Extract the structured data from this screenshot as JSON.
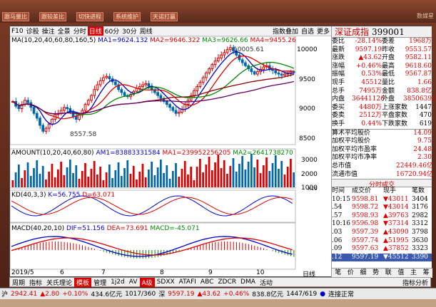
{
  "top_buttons": [
    "跟马量比",
    "跟较差比",
    "切快进程",
    "系统维护",
    "天诺打赢"
  ],
  "top_right": "数媒星",
  "toolbar": {
    "items": [
      "F10",
      "诊股",
      "操注",
      "全景",
      "分时",
      "日线",
      "60分",
      "30分",
      "周线"
    ],
    "selected": "日线",
    "right": [
      "指数叠加",
      "自选",
      "更多"
    ]
  },
  "yaxis": {
    "price": [
      "10000",
      "9500",
      "9000",
      "8500"
    ],
    "vol": [
      "3000",
      "2000",
      "1000"
    ],
    "vol_unit": "X10"
  },
  "price_high": "10005.61",
  "price_low": "8557.58",
  "ma_legend": {
    "type": "MA",
    "params": "(10,20,40,60,80,160,5)",
    "ma1": "MA1=9624.132",
    "ma2": "MA2=9646.322",
    "ma3": "MA3=9626.66",
    "ma4": "MA4=9455.26"
  },
  "amount_legend": {
    "name": "AMOUNT",
    "params": "(10,20,40,60,80)",
    "am1": "AM1=83883331584",
    "ma1": "MA1=239952256205",
    "ma2": "MA2=2641738270"
  },
  "kd_legend": {
    "name": "KD",
    "params": "(40,3,3)",
    "k": "K=56.755",
    "d": "D=63.071"
  },
  "macd_legend": {
    "name": "MACD",
    "params": "(40,20,10)",
    "dif": "DIF=51.156",
    "dea": "DEA=73.691",
    "macd": "MACD=-45.071"
  },
  "x_dates": [
    "2019/5",
    "6",
    "7",
    "8",
    "9",
    "10"
  ],
  "x_end": "日线",
  "sidebar": {
    "title": "深证成指",
    "code": "399001",
    "rows": [
      [
        "委比",
        "-28.14%",
        "委差",
        "1968万"
      ],
      [
        "最新",
        "9597.19",
        "昨收",
        "9553.57"
      ],
      [
        "涨跌",
        "▲43.62",
        "开盘",
        "9582.11"
      ],
      [
        "涨幅",
        "+0.46%",
        "最高",
        "9618.60"
      ],
      [
        "振幅",
        "0.53%",
        "最低",
        "9567.87"
      ],
      [
        "现手",
        "45512",
        "量比",
        "1.66"
      ],
      [
        "总手",
        "7495万",
        "金额",
        "838.8亿"
      ],
      [
        "内盘",
        "36441126",
        "外盘",
        "38506392"
      ],
      [
        "委买",
        "4480万",
        "上涨家数",
        "1447"
      ],
      [
        "委卖",
        "2512万",
        "平盘家数",
        "470"
      ],
      [
        "换手",
        "0.44%",
        "下跌家数",
        "619"
      ]
    ],
    "rows2": [
      [
        "算术平均股价",
        "14.09"
      ],
      [
        "加权平均股价",
        "9.75"
      ],
      [
        "加权平均市盈率",
        "24.48"
      ],
      [
        "加权平均市净率",
        "2.30"
      ],
      [
        "总市值",
        "22449.46亿"
      ],
      [
        "流通市值",
        "16720.94亿"
      ]
    ],
    "trade_header": [
      "时间",
      "成交价",
      "现手",
      "笔数"
    ],
    "trade_tab": "分时成交",
    "trades": [
      [
        "10:15",
        "9598.81",
        "▼43011",
        "3404"
      ],
      [
        ".54",
        "9598.72",
        "▼43014",
        "3176"
      ],
      [
        ".57",
        "9598.93",
        "▲39763",
        "2982"
      ],
      [
        "10:16",
        "9596.98",
        "▼37314",
        "3312"
      ],
      [
        ".03",
        "9597.39",
        "▲43090",
        "3798"
      ],
      [
        ".06",
        "9597.74",
        "▲51995",
        "3630"
      ],
      [
        ".09",
        "9597.63",
        "▲37852",
        "3323"
      ],
      [
        ".12",
        "9597.19",
        "▼45512",
        "3390"
      ]
    ],
    "bottom_tabs": [
      "笔",
      "价",
      "细",
      "势",
      "联",
      "值",
      "主",
      "筹"
    ]
  },
  "bottom_tabs": [
    "周期",
    "指标",
    "关氏理论",
    "模板",
    "管理",
    "1j2d",
    "AV",
    "A级",
    "SDXX",
    "ATAFI",
    "ABC",
    "ZDCR",
    "DMA",
    "活动"
  ],
  "bottom_selected": [
    "模板",
    "A级"
  ],
  "bottom_right": "指标分析",
  "status": {
    "name": "沪",
    "v1": "2942.41",
    "v2": "▲2.80",
    "v3": "+0.10%",
    "v4": "434.6亿元",
    "v5": "1017/360",
    "v6": "深",
    "v7": "9597.19",
    "v8": "▲43.62",
    "v9": "+0.46%",
    "v10": "838.8亿元",
    "v11": "1447/619",
    "v12": "连接正常"
  },
  "chart_data": {
    "type": "candlestick",
    "candles": [
      9100,
      9020,
      8980,
      9050,
      9120,
      9080,
      9000,
      8900,
      8820,
      8700,
      8600,
      8650,
      8720,
      8800,
      8880,
      8900,
      8950,
      9000,
      8980,
      8920,
      8850,
      8800,
      8870,
      8950,
      9050,
      9120,
      9200,
      9300,
      9380,
      9450,
      9500,
      9520,
      9480,
      9430,
      9380,
      9300,
      9250,
      9200,
      9180,
      9220,
      9270,
      9320,
      9350,
      9380,
      9400,
      9360,
      9300,
      9250,
      9200,
      9150,
      9100,
      9050,
      9000,
      8950,
      8900,
      8920,
      8970,
      9050,
      9120,
      9200,
      9280,
      9350,
      9420,
      9500,
      9580,
      9650,
      9720,
      9780,
      9830,
      9880,
      9920,
      9970,
      10005,
      9950,
      9880,
      9800,
      9750,
      9700,
      9650,
      9600,
      9560,
      9600,
      9640,
      9680,
      9700,
      9650,
      9620,
      9580,
      9560,
      9540,
      9560,
      9580,
      9600,
      9597
    ],
    "ylim": [
      8400,
      10050
    ]
  }
}
